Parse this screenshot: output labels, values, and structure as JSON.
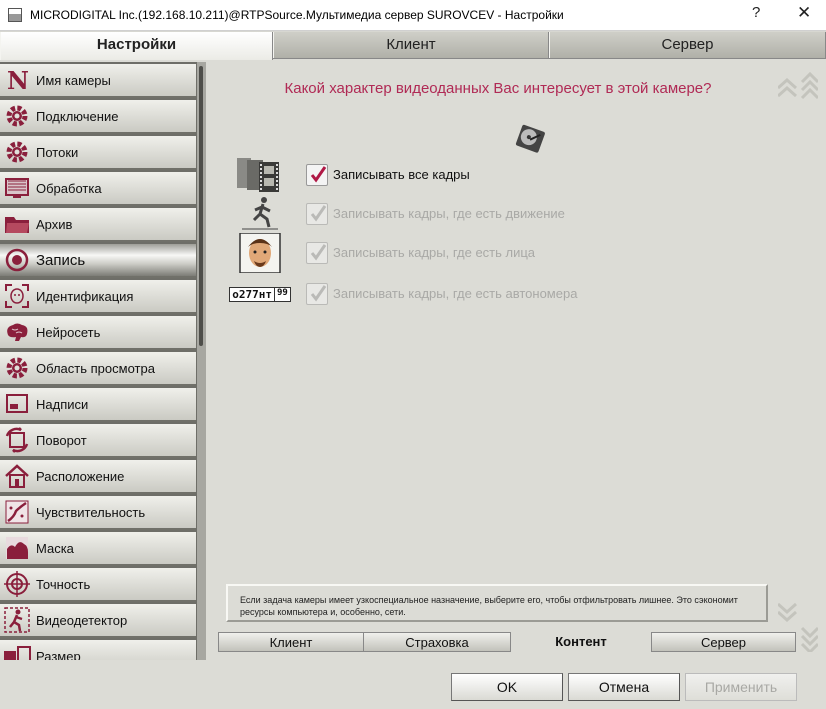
{
  "window": {
    "title": "MICRODIGITAL Inc.(192.168.10.211)@RTPSource.Мультимедиа сервер SUROVCEV - Настройки",
    "help": "?",
    "close": "✕"
  },
  "main_tabs": [
    {
      "label": "Настройки",
      "active": true
    },
    {
      "label": "Клиент",
      "active": false
    },
    {
      "label": "Сервер",
      "active": false
    }
  ],
  "sidebar": {
    "items": [
      {
        "label": "Имя камеры",
        "icon": "camera-name-icon"
      },
      {
        "label": "Подключение",
        "icon": "gear-icon"
      },
      {
        "label": "Потоки",
        "icon": "gear-icon"
      },
      {
        "label": "Обработка",
        "icon": "monitor-icon"
      },
      {
        "label": "Архив",
        "icon": "folder-icon"
      },
      {
        "label": "Запись",
        "icon": "record-icon",
        "active": true
      },
      {
        "label": "Идентификация",
        "icon": "face-icon"
      },
      {
        "label": "Нейросеть",
        "icon": "brain-icon"
      },
      {
        "label": "Область просмотра",
        "icon": "gear-icon"
      },
      {
        "label": "Надписи",
        "icon": "caption-icon"
      },
      {
        "label": "Поворот",
        "icon": "rotate-icon"
      },
      {
        "label": "Расположение",
        "icon": "house-icon"
      },
      {
        "label": "Чувствительность",
        "icon": "sensitivity-icon"
      },
      {
        "label": "Маска",
        "icon": "mask-icon"
      },
      {
        "label": "Точность",
        "icon": "target-icon"
      },
      {
        "label": "Видеодетектор",
        "icon": "running-man-icon"
      },
      {
        "label": "Размер",
        "icon": "size-icon"
      }
    ]
  },
  "content": {
    "question": "Какой характер видеоданных Вас интересует в этой камере?",
    "options": [
      {
        "label": "Записывать все кадры",
        "checked": true,
        "enabled": true,
        "icon": "film-icon"
      },
      {
        "label": "Записывать кадры, где есть движение",
        "checked": true,
        "enabled": false,
        "icon": "running-man-icon"
      },
      {
        "label": "Записывать кадры, где есть лица",
        "checked": true,
        "enabled": false,
        "icon": "face-portrait-icon"
      },
      {
        "label": "Записывать кадры, где есть автономера",
        "checked": true,
        "enabled": false,
        "icon": "license-plate-icon"
      }
    ],
    "plate": {
      "number": "о277нт",
      "region": "99"
    },
    "hint": "Если задача камеры имеет узкоспециальное назначение, выберите его, чтобы отфильтровать лишнее. Это сэкономит ресурсы компьютера и, особенно, сети."
  },
  "sub_tabs": [
    {
      "label": "Клиент",
      "active": false
    },
    {
      "label": "Страховка",
      "active": false
    },
    {
      "label": "Контент",
      "active": true
    },
    {
      "label": "Сервер",
      "active": false
    }
  ],
  "buttons": {
    "ok": "OK",
    "cancel": "Отмена",
    "apply": "Применить"
  },
  "colors": {
    "accent": "#b02a55",
    "icon": "#8a1f3c",
    "panel": "#dcdcd6"
  }
}
